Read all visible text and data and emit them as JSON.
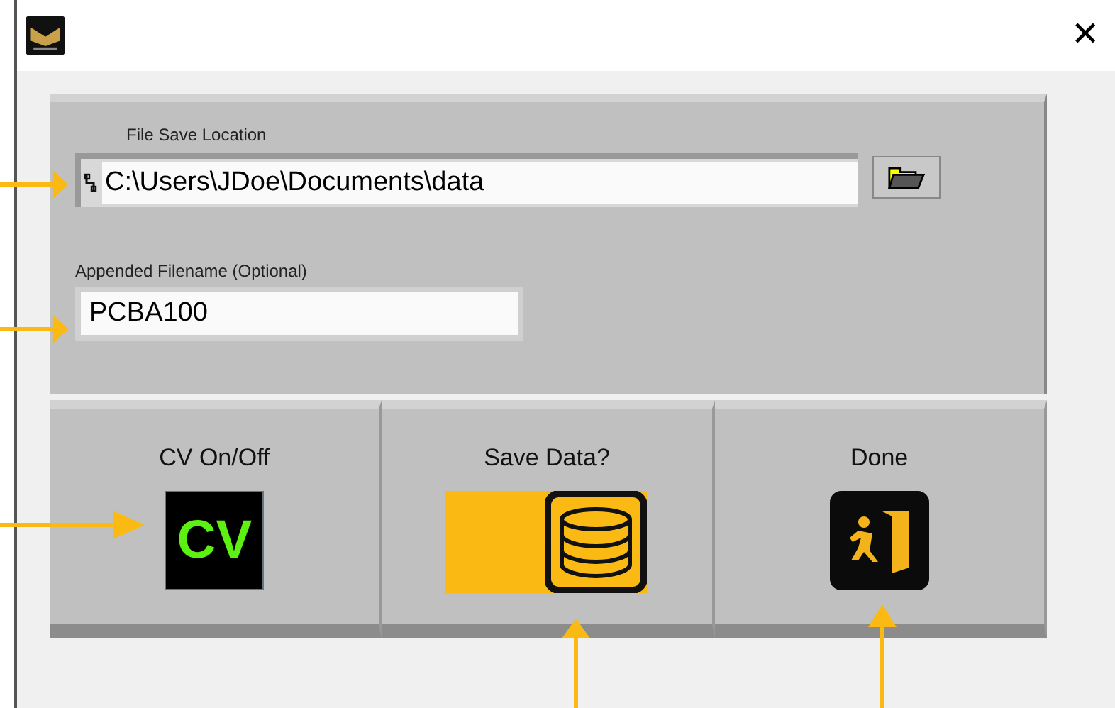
{
  "window": {
    "close_glyph": "✕"
  },
  "file_location": {
    "label": "File Save Location",
    "value": "C:\\Users\\JDoe\\Documents\\data"
  },
  "appended_filename": {
    "label": "Appended Filename (Optional)",
    "value": "PCBA100"
  },
  "buttons": [
    {
      "kind": "cv",
      "label": "CV On/Off",
      "icon_text": "CV",
      "on": true
    },
    {
      "kind": "save",
      "label": "Save Data?",
      "on": true
    },
    {
      "kind": "done",
      "label": "Done"
    }
  ]
}
